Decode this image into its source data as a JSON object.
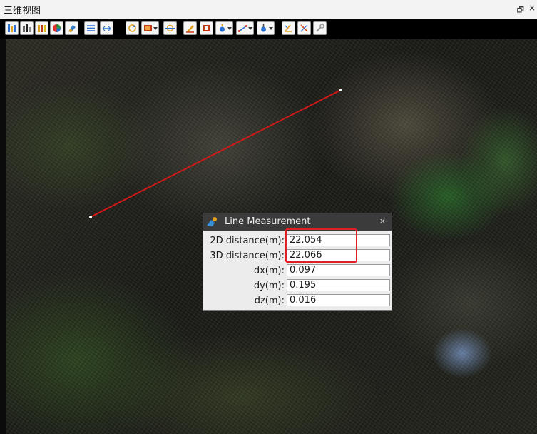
{
  "window": {
    "title": "三维视图",
    "restore_icon": "restore-icon",
    "close_icon": "close-icon"
  },
  "toolbar": {
    "buttons": [
      {
        "icon": "elevation-color-icon",
        "color": "#2a6fd0"
      },
      {
        "icon": "intensity-color-icon",
        "color": "#444444"
      },
      {
        "icon": "classification-color-icon",
        "color": "#e0a020"
      },
      {
        "icon": "rgb-color-icon",
        "color": "#e03030"
      },
      {
        "icon": "eraser-icon",
        "color": "#3a80c8"
      },
      {
        "icon": "filter-icon",
        "color": "#2a6fd0"
      },
      {
        "icon": "fit-view-icon",
        "color": "#2a6fd0"
      },
      {
        "icon": "rotate-icon",
        "color": "#e0a020"
      },
      {
        "icon": "view-dropdown-icon",
        "color": "#c03a10"
      },
      {
        "icon": "center-target-icon",
        "color": "#e0a020"
      },
      {
        "icon": "draw-polygon-icon",
        "color": "#e0a020"
      },
      {
        "icon": "clip-box-icon",
        "color": "#c03a10"
      },
      {
        "icon": "select-point-dropdown-icon",
        "color": "#2a6fd0"
      },
      {
        "icon": "measure-line-dropdown-icon",
        "color": "#2a6fd0"
      },
      {
        "icon": "measure-height-dropdown-icon",
        "color": "#2a6fd0"
      },
      {
        "icon": "measure-angle-icon",
        "color": "#e0a020"
      },
      {
        "icon": "clear-measure-icon",
        "color": "#e05020"
      },
      {
        "icon": "settings-tools-icon",
        "color": "#999999"
      }
    ]
  },
  "measurement_line": {
    "color": "#d21818"
  },
  "dialog": {
    "title": "Line Measurement",
    "icon": "measure-tool-icon",
    "close": "×",
    "rows": [
      {
        "label": "2D distance(m):",
        "value": "22.054"
      },
      {
        "label": "3D distance(m):",
        "value": "22.066"
      },
      {
        "label": "dx(m):",
        "value": "0.097"
      },
      {
        "label": "dy(m):",
        "value": "0.195"
      },
      {
        "label": "dz(m):",
        "value": "0.016"
      }
    ]
  },
  "annotation": {
    "highlight_color": "#e02020"
  }
}
